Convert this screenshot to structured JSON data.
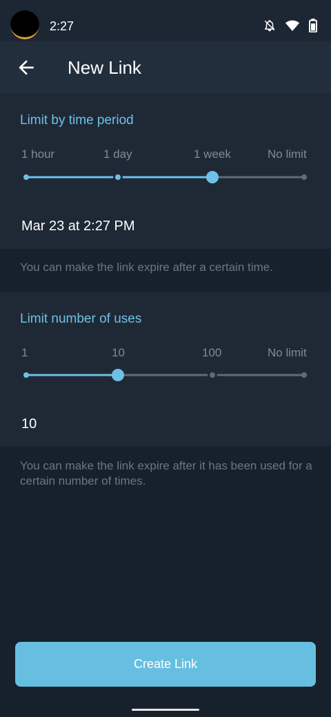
{
  "status_bar": {
    "time": "2:27",
    "icons": [
      "bell-off-icon",
      "wifi-icon",
      "battery-icon"
    ]
  },
  "app_bar": {
    "back_icon": "arrow-left-icon",
    "title": "New Link"
  },
  "time_period": {
    "title": "Limit by time period",
    "ticks": [
      "1 hour",
      "1 day",
      "1 week",
      "No limit"
    ],
    "selected_index": 2,
    "value": "Mar 23 at 2:27 PM",
    "hint": "You can make the link expire after a certain time."
  },
  "uses": {
    "title": "Limit number of uses",
    "ticks": [
      "1",
      "10",
      "100",
      "No limit"
    ],
    "selected_index": 1,
    "value": "10",
    "hint": "You can make the link expire after it has been used for a certain number of times."
  },
  "create_button": {
    "label": "Create Link"
  },
  "colors": {
    "background": "#17212b",
    "section": "#1f2935",
    "app_bar": "#232e3c",
    "accent": "#6dc1e8",
    "button": "#66bfe0",
    "track_inactive": "#5f6d73"
  }
}
